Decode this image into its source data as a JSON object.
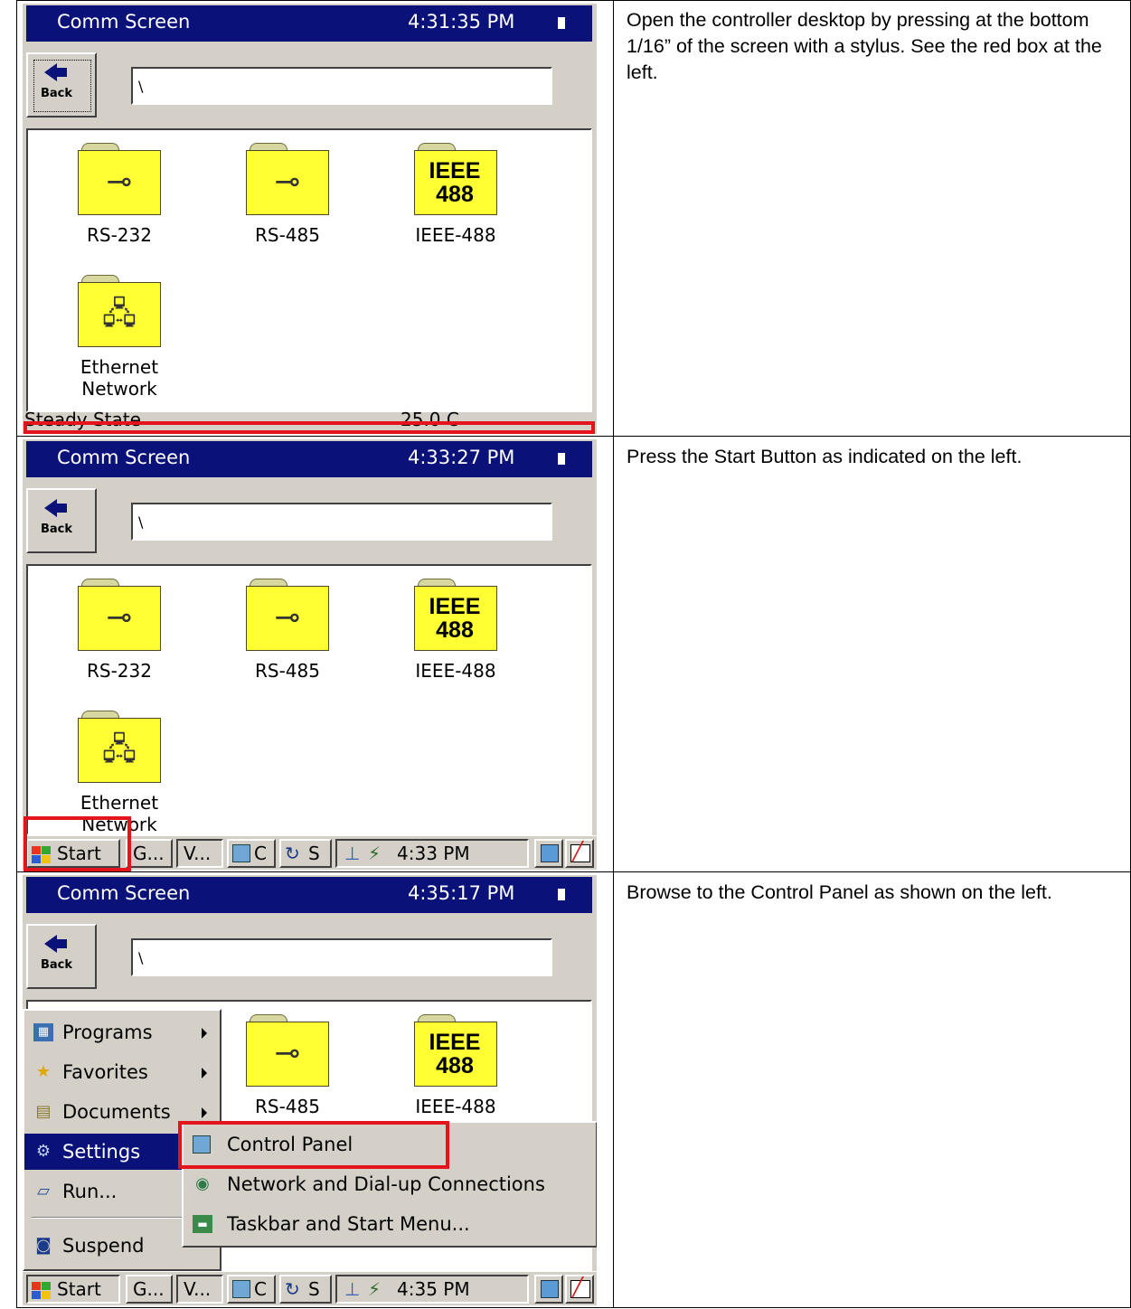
{
  "steps": [
    {
      "instruction": "Open the controller desktop by pressing at the bottom 1/16” of the screen with a stylus. See the red box at the left.",
      "screen": {
        "title": "Comm Screen",
        "clock": "4:31:35 PM"
      }
    },
    {
      "instruction": "Press the Start Button as indicated on the left.",
      "screen": {
        "title": "Comm Screen",
        "clock": "4:33:27 PM"
      }
    },
    {
      "instruction": "Browse to the Control Panel as shown on the left.",
      "screen": {
        "title": "Comm Screen",
        "clock": "4:35:17 PM"
      }
    }
  ],
  "device": {
    "back_label": "Back",
    "path_value": "\\",
    "items": [
      "RS-232",
      "RS-485",
      "IEEE-488",
      "Ethernet Network"
    ],
    "ieee_glyph_line1": "IEEE",
    "ieee_glyph_line2": "488",
    "status_left": "Steady State",
    "status_right": "25.0 C"
  },
  "taskbar": {
    "start_label": "Start",
    "task1": "G...",
    "task2": "V...",
    "task3": "C",
    "task4": "S",
    "tray_time_step2": "4:33 PM",
    "tray_time_step3": "4:35 PM"
  },
  "start_menu": {
    "items": [
      {
        "label": "Programs",
        "icon": "programs-icon",
        "has_submenu": true
      },
      {
        "label": "Favorites",
        "icon": "star-icon",
        "has_submenu": true
      },
      {
        "label": "Documents",
        "icon": "documents-icon",
        "has_submenu": true
      },
      {
        "label": "Settings",
        "icon": "settings-icon",
        "has_submenu": true,
        "selected": true
      },
      {
        "label": "Run...",
        "icon": "run-icon",
        "has_submenu": false
      },
      {
        "label": "Suspend",
        "icon": "suspend-icon",
        "has_submenu": false
      }
    ],
    "settings_submenu": [
      {
        "label": "Control Panel",
        "icon": "control-panel-icon",
        "highlighted": true
      },
      {
        "label": "Network and Dial-up Connections",
        "icon": "network-icon"
      },
      {
        "label": "Taskbar and Start Menu...",
        "icon": "taskbar-icon"
      }
    ]
  },
  "colors": {
    "title_bar": "#0a1279",
    "highlight_box": "#e3141b",
    "folder": "#ffff33"
  }
}
